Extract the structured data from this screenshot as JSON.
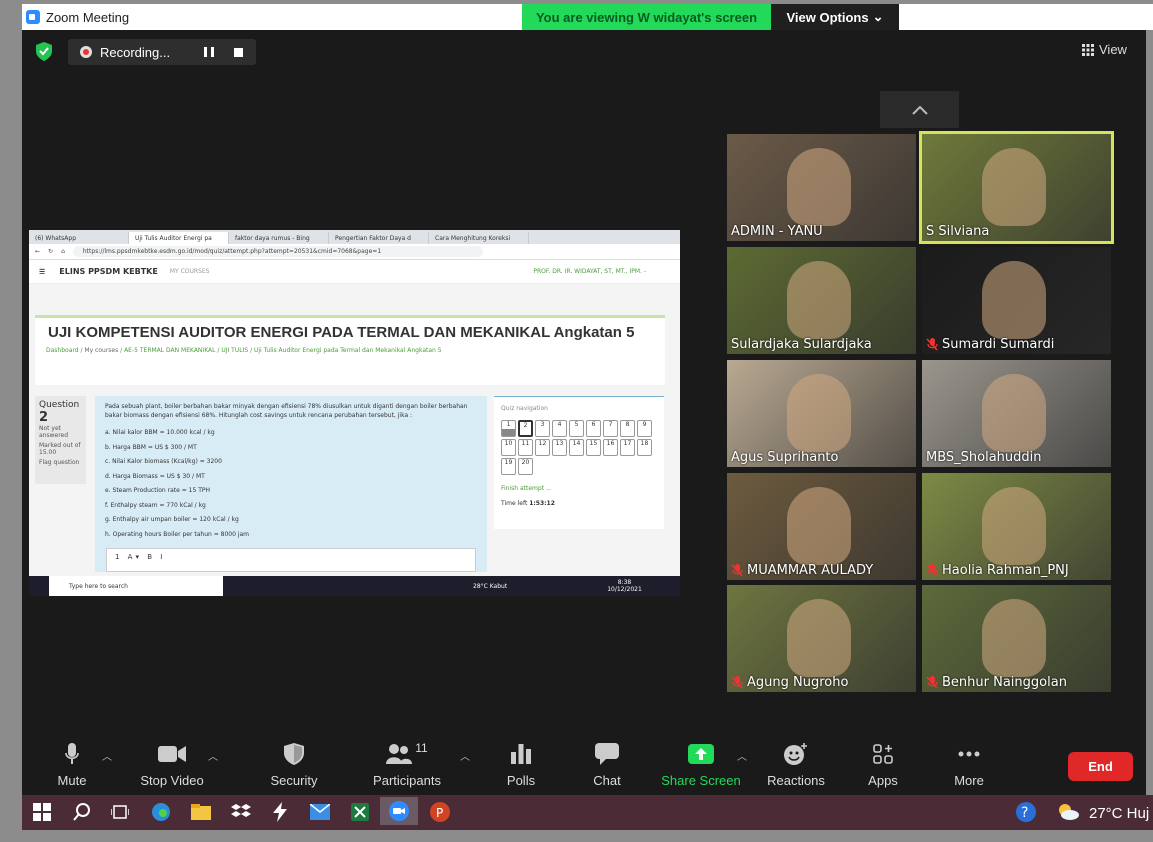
{
  "window": {
    "title": "Zoom Meeting"
  },
  "view_banner": {
    "text": "You are viewing W widayat's screen",
    "options_label": "View Options"
  },
  "recording": {
    "label": "Recording..."
  },
  "view_button": {
    "label": "View"
  },
  "shared_screen": {
    "tabs": [
      "(6) WhatsApp",
      "Uji Tulis Auditor Energi pa",
      "faktor daya rumus - Bing",
      "Pengertian Faktor Daya d",
      "Cara Menghitung Koreksi"
    ],
    "url": "https://lms.ppsdmkebtke.esdm.go.id/mod/quiz/attempt.php?attempt=20531&cmid=7068&page=1",
    "site_name": "ELINS PPSDM KEBTKE",
    "my_courses": "MY COURSES",
    "user_name": "PROF. DR. IR. WIDAYAT, ST, MT., IPM. -",
    "page_title": "UJI KOMPETENSI AUDITOR ENERGI PADA TERMAL DAN MEKANIKAL Angkatan 5",
    "breadcrumb": [
      "Dashboard",
      "My courses",
      "AE-5 TERMAL DAN MEKANIKAL",
      "UJI TULIS",
      "Uji Tulis Auditor Energi pada Termal dan Mekanikal Angkatan 5"
    ],
    "question": {
      "label": "Question",
      "number": "2",
      "status": "Not yet answered",
      "marks": "Marked out of 15.00",
      "flag": "Flag question"
    },
    "question_text": [
      "Pada sebuah plant, boiler berbahan bakar minyak dengan efisiensi 78% diusulkan untuk diganti dengan boiler berbahan bakar biomass dengan efisiensi 68%. Hitunglah cost savings untuk rencana perubahan tersebut, jika :",
      "a. Nilai kalor BBM = 10.000 kcal / kg",
      "b. Harga BBM = US $ 300 / MT",
      "c. Nilai Kalor biomass (Kcal/kg) = 3200",
      "d. Harga Biomass = US $ 30 / MT",
      "e. Steam Production rate = 15 TPH",
      "f. Enthalpy steam = 770 kCal / kg",
      "g. Enthalpy air umpan boiler = 120 kCal / kg",
      "h. Operating hours Boiler per tahun = 8000 jam"
    ],
    "editor_toolbar": "1  A▾  B  I",
    "quiz_nav": {
      "title": "Quiz navigation",
      "numbers": [
        "1",
        "2",
        "3",
        "4",
        "5",
        "6",
        "7",
        "8",
        "9",
        "10",
        "11",
        "12",
        "13",
        "14",
        "15",
        "16",
        "17",
        "18",
        "19",
        "20"
      ],
      "finish": "Finish attempt ...",
      "time_label": "Time left",
      "time_value": "1:53:12"
    },
    "taskbar": {
      "search": "Type here to search",
      "weather": "28°C  Kabut",
      "time": "8:38",
      "date": "10/12/2021"
    }
  },
  "participants": [
    {
      "name": "ADMIN - YANU",
      "muted": false,
      "active": false,
      "bg": "#6b5a48"
    },
    {
      "name": "S Silviana",
      "muted": false,
      "active": true,
      "bg": "#6f7a3a"
    },
    {
      "name": "Sulardjaka Sulardjaka",
      "muted": false,
      "active": false,
      "bg": "#5d6a33"
    },
    {
      "name": "Sumardi Sumardi",
      "muted": true,
      "active": false,
      "bg": "#1b1b1b"
    },
    {
      "name": "Agus Suprihanto",
      "muted": false,
      "active": false,
      "bg": "#b9a992"
    },
    {
      "name": "MBS_Sholahuddin",
      "muted": false,
      "active": false,
      "bg": "#9a968e"
    },
    {
      "name": "MUAMMAR AULADY",
      "muted": true,
      "active": false,
      "bg": "#6d5b3e"
    },
    {
      "name": "Haolia Rahman_PNJ",
      "muted": true,
      "active": false,
      "bg": "#7d8a44"
    },
    {
      "name": "Agung Nugroho",
      "muted": true,
      "active": false,
      "bg": "#6e7540"
    },
    {
      "name": "Benhur Nainggolan",
      "muted": true,
      "active": false,
      "bg": "#5d6a3a"
    }
  ],
  "toolbar": {
    "mute": "Mute",
    "stop_video": "Stop Video",
    "security": "Security",
    "participants": "Participants",
    "participants_count": "11",
    "polls": "Polls",
    "chat": "Chat",
    "share_screen": "Share Screen",
    "reactions": "Reactions",
    "apps": "Apps",
    "more": "More",
    "end": "End"
  },
  "win_taskbar": {
    "weather": "27°C  Huj"
  },
  "colors": {
    "share_green": "#23d959",
    "end_red": "#e02828",
    "active_outline": "#d6e35a",
    "stage_bg": "#1a1a1a"
  }
}
